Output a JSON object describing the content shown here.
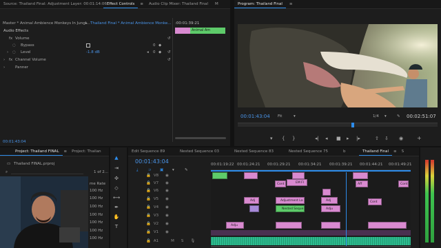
{
  "effect_controls": {
    "tabs": [
      {
        "label": "Source: Thailand Final: Adjustment Layer: 00:01:14:06"
      },
      {
        "label": "Effect Controls"
      },
      {
        "label": "Audio Clip Mixer: Thailand Final"
      },
      {
        "label": "M"
      }
    ],
    "master_label": "Master * Animal Ambience Monkeys In Jungl...",
    "sequence_label": "Thailand Final * Animal Ambience Monke...",
    "ruler_time": ":00:01:39:21",
    "clip_label": "Animal Am",
    "section_header": "Audio Effects",
    "fx_volume": "Volume",
    "bypass_label": "Bypass",
    "level_label": "Level",
    "level_value": "-1.8 dB",
    "zero1": "0",
    "zero2": "0",
    "channel_volume": "Channel Volume",
    "panner": "Panner",
    "timecode": "00:01:43:04"
  },
  "program": {
    "title": "Program: Thailand Final",
    "timecode": "00:01:43:04",
    "fit": "Fit",
    "ratio": "1/4",
    "duration": "00:02:51:07"
  },
  "project": {
    "tabs": [
      {
        "label": "Project: Thailand FINAL"
      },
      {
        "label": "Project: Thailan"
      }
    ],
    "file": "Thailand FINAL.prproj",
    "count": "1 of 2...",
    "col_header": "me Rate",
    "rates": [
      "100 Hz",
      "100 Hz",
      "100 Hz",
      "100 Hz",
      "100 Hz",
      "100 Hz",
      "100 Hz"
    ]
  },
  "timeline": {
    "tabs": [
      {
        "label": "Edit Sequence 89"
      },
      {
        "label": "Nested Sequence 03"
      },
      {
        "label": "Nested Sequence 83"
      },
      {
        "label": "Nested Sequence 75"
      },
      {
        "label": "b"
      },
      {
        "label": "Thailand Final"
      },
      {
        "label": "S"
      }
    ],
    "timecode": "00:01:43:04",
    "ruler": [
      "00:01:19:22",
      "00:01:24:21",
      "00:01:29:21",
      "00:01:34:21",
      "00:01:39:21",
      "00:01:44:21",
      "00:01:49:21"
    ],
    "tracks": [
      "V8",
      "V7",
      "V6",
      "V5",
      "V4",
      "V3",
      "V2",
      "V1",
      "A1"
    ],
    "clip_labels": {
      "c1": "EM Fl",
      "c2": "Cont",
      "c3": "Aff",
      "c4": "Adj",
      "c5": "Adjustment La",
      "c6": "Nested Seque",
      "c7": "Adju",
      "c8": "Adju",
      "c9": "Adj",
      "c10": "Cont",
      "c11": "Cont"
    },
    "a1_m": "M",
    "a1_s": "S"
  },
  "colors": {
    "accent": "#2d8ceb",
    "pink": "#d98ad0",
    "green": "#5ecb6a",
    "audio": "#2dbb8f"
  }
}
